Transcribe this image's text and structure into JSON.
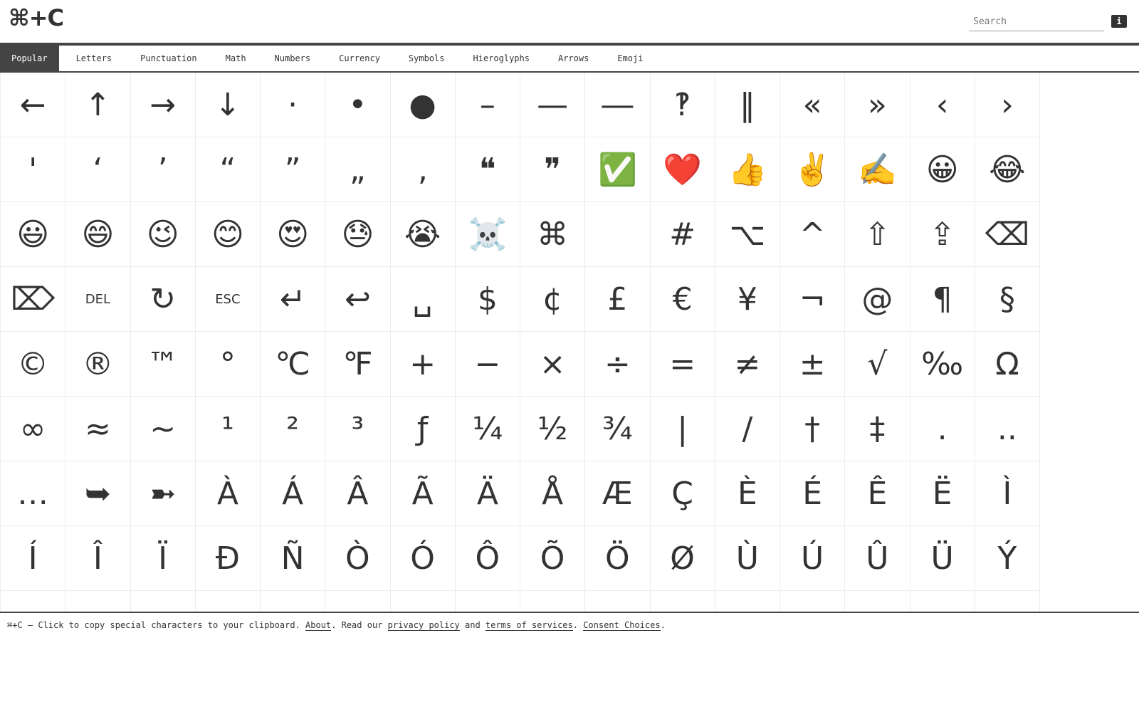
{
  "header": {
    "logo": "⌘+C",
    "search_placeholder": "Search",
    "info_label": "i"
  },
  "tabs": [
    {
      "label": "Popular",
      "active": true
    },
    {
      "label": "Letters"
    },
    {
      "label": "Punctuation"
    },
    {
      "label": "Math"
    },
    {
      "label": "Numbers"
    },
    {
      "label": "Currency"
    },
    {
      "label": "Symbols"
    },
    {
      "label": "Hieroglyphs"
    },
    {
      "label": "Arrows"
    },
    {
      "label": "Emoji"
    }
  ],
  "characters": [
    "←",
    "↑",
    "→",
    "↓",
    "·",
    "•",
    "●",
    "–",
    "—",
    "―",
    "‽",
    "‖",
    "«",
    "»",
    "‹",
    "›",
    "'",
    "‘",
    "’",
    "“",
    "”",
    "„",
    "‚",
    "❝",
    "❞",
    "✅",
    "❤️",
    "👍",
    "✌️",
    "✍️",
    "😀",
    "😂",
    "😃",
    "😄",
    "😉",
    "😊",
    "😍",
    "😓",
    "😭",
    "☠️",
    "⌘",
    "",
    "#",
    "⌥",
    "^",
    "⇧",
    "⇪",
    "⌫",
    "⌦",
    "DEL",
    "↻",
    "ESC",
    "↵",
    "↩",
    "␣",
    "$",
    "¢",
    "£",
    "€",
    "¥",
    "¬",
    "@",
    "¶",
    "§",
    "©",
    "®",
    "™",
    "°",
    "℃",
    "℉",
    "+",
    "−",
    "×",
    "÷",
    "=",
    "≠",
    "±",
    "√",
    "‰",
    "Ω",
    "∞",
    "≈",
    "~",
    "¹",
    "²",
    "³",
    "ƒ",
    "¼",
    "½",
    "¾",
    "|",
    "/",
    "†",
    "‡",
    ".",
    "..",
    "…",
    "➥",
    "➼",
    "À",
    "Á",
    "Â",
    "Ã",
    "Ä",
    "Å",
    "Æ",
    "Ç",
    "È",
    "É",
    "Ê",
    "Ë",
    "Ì",
    "Í",
    "Î",
    "Ï",
    "Đ",
    "Ñ",
    "Ò",
    "Ó",
    "Ô",
    "Õ",
    "Ö",
    "Ø",
    "Ù",
    "Ú",
    "Û",
    "Ü",
    "Ý",
    "",
    "",
    "",
    "",
    "",
    "",
    "",
    "",
    "",
    "",
    "",
    "",
    "",
    "",
    "",
    ""
  ],
  "footer": {
    "text_before": "⌘+C – Click to copy special characters to your clipboard. ",
    "about": "About",
    "text_read": ". Read our ",
    "privacy": "privacy policy",
    "text_and": " and ",
    "terms": "terms of services",
    "text_dot": ". ",
    "consent": "Consent Choices",
    "text_end": "."
  }
}
